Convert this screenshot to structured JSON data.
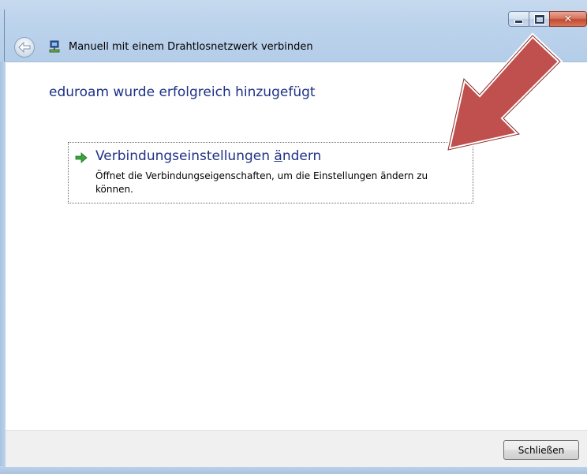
{
  "window": {
    "title": "Manuell mit einem Drahtlosnetzwerk verbinden",
    "caption_buttons": {
      "minimize_icon": "minimize-icon",
      "maximize_icon": "maximize-icon",
      "close_icon": "close-icon",
      "close_glyph": "✕"
    },
    "back_icon": "back-arrow-icon",
    "app_icon": "wireless-network-icon"
  },
  "content": {
    "heading": "eduroam wurde erfolgreich hinzugefügt",
    "command_link": {
      "title_before": "Verbindungseinstellungen ",
      "title_accesskey": "ä",
      "title_after": "ndern",
      "description": "Öffnet die Verbindungseigenschaften, um die Einstellungen ändern zu können.",
      "icon": "green-arrow-icon"
    }
  },
  "footer": {
    "close_label": "Schließen"
  },
  "annotation": {
    "icon": "red-pointer-arrow",
    "color": "#c0504d"
  },
  "colors": {
    "heading_blue": "#1e3287",
    "frame_blue": "#bcd3ec"
  }
}
